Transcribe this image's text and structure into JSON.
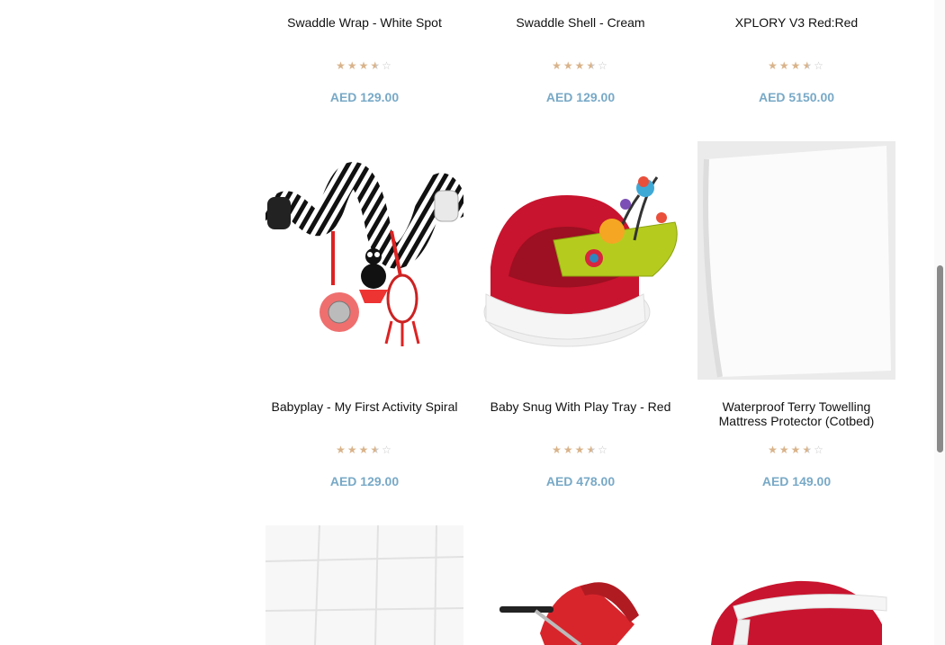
{
  "products": [
    {
      "title": "Swaddle Wrap - White Spot",
      "rating": 3.5,
      "price": "AED 129.00",
      "image": "swaddle-wrap-image"
    },
    {
      "title": "Swaddle Shell - Cream",
      "rating": 3.5,
      "price": "AED 129.00",
      "image": "swaddle-shell-image"
    },
    {
      "title": "XPLORY V3 Red:Red",
      "rating": 3.5,
      "price": "AED 5150.00",
      "image": "stroller-image"
    },
    {
      "title": "Babyplay - My First Activity Spiral",
      "rating": 3.5,
      "price": "AED 129.00",
      "image": "activity-spiral-image"
    },
    {
      "title": "Baby Snug With Play Tray - Red",
      "rating": 3.5,
      "price": "AED 478.00",
      "image": "baby-snug-image"
    },
    {
      "title": "Waterproof Terry Towelling Mattress Protector (Cotbed)",
      "rating": 3.5,
      "price": "AED 149.00",
      "image": "mattress-protector-image"
    }
  ],
  "stars": {
    "full": "★",
    "empty": "☆"
  },
  "colors": {
    "price": "#78a9c7",
    "star": "#d9b38a",
    "snug_red": "#c8142e",
    "tray_green": "#b5cc1f"
  }
}
